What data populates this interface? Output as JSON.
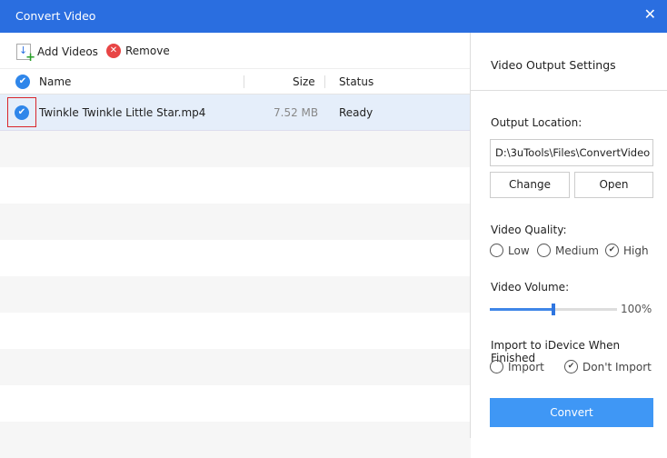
{
  "window": {
    "title": "Convert Video",
    "close": "✕"
  },
  "toolbar": {
    "add": "Add Videos",
    "remove": "Remove"
  },
  "table": {
    "columns": {
      "name": "Name",
      "size": "Size",
      "status": "Status"
    },
    "rows": [
      {
        "name": "Twinkle Twinkle Little Star.mp4",
        "size": "7.52 MB",
        "status": "Ready",
        "checked": true
      }
    ]
  },
  "settings": {
    "title": "Video Output Settings",
    "output_label": "Output Location:",
    "output_path": "D:\\3uTools\\Files\\ConvertVideo",
    "change": "Change",
    "open": "Open",
    "quality_label": "Video Quality:",
    "quality": {
      "low": "Low",
      "medium": "Medium",
      "high": "High",
      "selected": "High"
    },
    "volume_label": "Video Volume:",
    "volume_value": "100%",
    "volume_slider_fraction": 0.5,
    "import_label": "Import to iDevice When Finished",
    "import": {
      "yes": "Import",
      "no": "Don't Import",
      "selected": "Don't Import"
    },
    "convert": "Convert"
  },
  "colors": {
    "accent": "#2a6ee0",
    "button": "#3f97f5",
    "selected_row": "#e5eefa"
  }
}
